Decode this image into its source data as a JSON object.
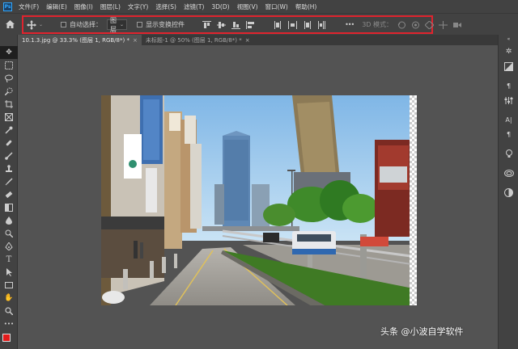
{
  "app": {
    "logo": "Ps"
  },
  "menubar": {
    "items": [
      "文件(F)",
      "编辑(E)",
      "图像(I)",
      "图层(L)",
      "文字(Y)",
      "选择(S)",
      "滤镜(T)",
      "3D(D)",
      "视图(V)",
      "窗口(W)",
      "帮助(H)"
    ]
  },
  "options": {
    "auto_select_label": "自动选择：",
    "auto_select_value": "图层",
    "show_transform_label": "显示变换控件",
    "more_label": "•••",
    "mode_3d_label": "3D 模式："
  },
  "tabs": [
    {
      "label": "10.1.3.jpg @ 33.3% (图层 1, RGB/8*) *",
      "active": true
    },
    {
      "label": "未标题-1 @ 50% (图层 1, RGB/8*) *",
      "active": false
    }
  ],
  "watermark": "头条 @小波自学软件",
  "colors": {
    "foreground": "#e21a1a",
    "background": "#ffffff",
    "highlight_border": "#e0232e"
  }
}
